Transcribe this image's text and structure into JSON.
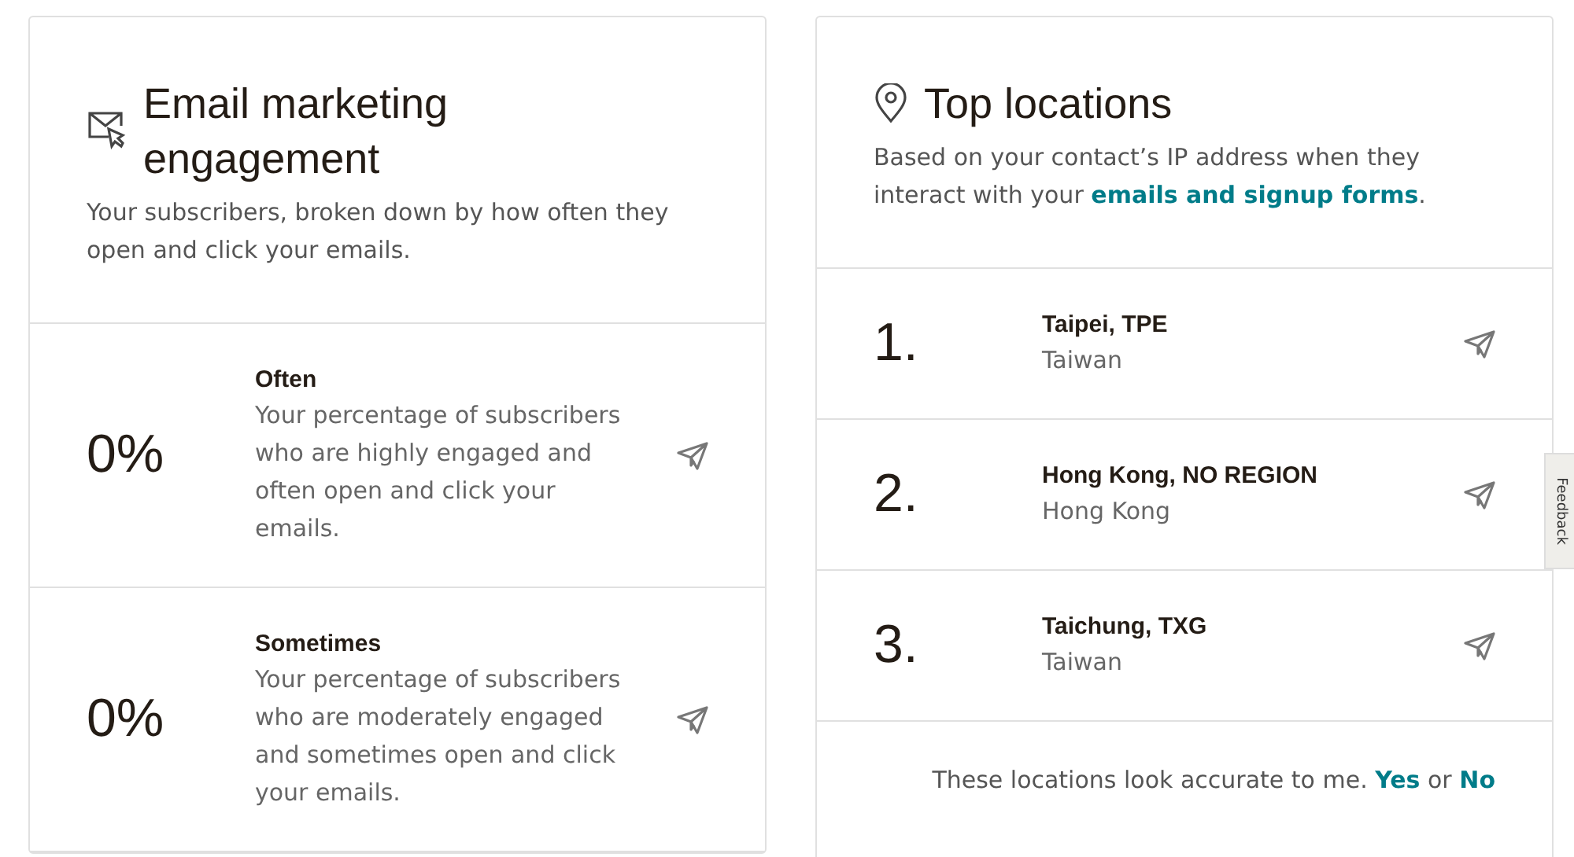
{
  "engagement": {
    "title": "Email marketing engagement",
    "description": "Your subscribers, broken down by how often they open and click your emails.",
    "rows": [
      {
        "value": "0%",
        "label": "Often",
        "description": "Your percentage of subscribers who are highly engaged and often open and click your emails."
      },
      {
        "value": "0%",
        "label": "Sometimes",
        "description": "Your percentage of subscribers who are moderately engaged and sometimes open and click your emails."
      }
    ]
  },
  "locations": {
    "title": "Top locations",
    "description_start": "Based on your contact’s IP address when they interact with your ",
    "description_link": "emails and signup forms",
    "description_end": ".",
    "items": [
      {
        "rank": "1.",
        "city": "Taipei, TPE",
        "country": "Taiwan"
      },
      {
        "rank": "2.",
        "city": "Hong Kong, NO REGION",
        "country": "Hong Kong"
      },
      {
        "rank": "3.",
        "city": "Taichung, TXG",
        "country": "Taiwan"
      }
    ],
    "feedback_question": "These locations look accurate to me.",
    "yes": "Yes",
    "or": "or",
    "no": "No"
  },
  "feedback_tab": "Feedback"
}
